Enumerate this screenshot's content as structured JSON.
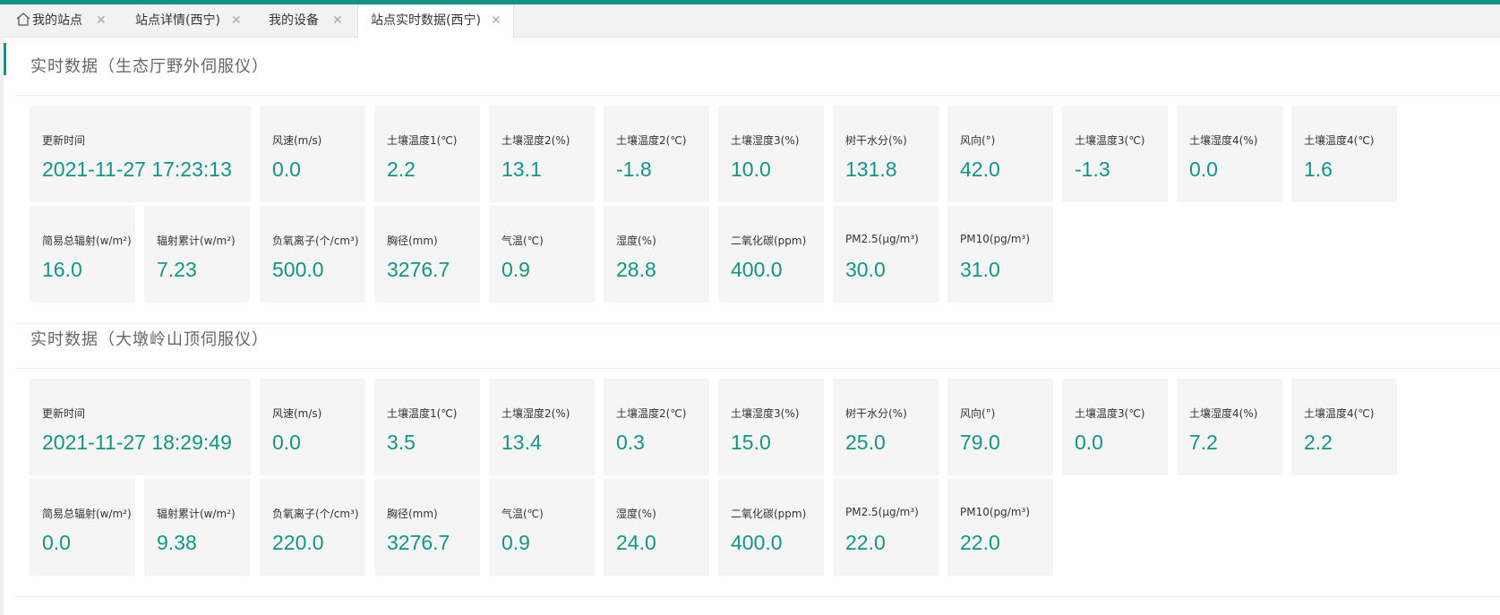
{
  "colors": {
    "accent": "#129586",
    "card_bg": "#f5f5f5",
    "value_text": "#129586"
  },
  "tabs": [
    {
      "label": "我的站点",
      "icon": "home-icon",
      "active": false
    },
    {
      "label": "站点详情(西宁)",
      "active": false
    },
    {
      "label": "我的设备",
      "active": false
    },
    {
      "label": "站点实时数据(西宁)",
      "active": true
    }
  ],
  "close_glyph": "✕",
  "sections": [
    {
      "title": "实时数据（生态厅野外伺服仪）",
      "rows": [
        [
          {
            "label": "更新时间",
            "value": "2021-11-27 17:23:13"
          },
          {
            "label": "风速(m/s)",
            "value": "0.0"
          },
          {
            "label": "土壤温度1(℃)",
            "value": "2.2"
          },
          {
            "label": "土壤湿度2(%)",
            "value": "13.1"
          },
          {
            "label": "土壤温度2(℃)",
            "value": "-1.8"
          },
          {
            "label": "土壤湿度3(%)",
            "value": "10.0"
          },
          {
            "label": "树干水分(%)",
            "value": "131.8"
          },
          {
            "label": "风向(°)",
            "value": "42.0"
          },
          {
            "label": "土壤温度3(℃)",
            "value": "-1.3"
          },
          {
            "label": "土壤湿度4(%)",
            "value": "0.0"
          },
          {
            "label": "土壤温度4(℃)",
            "value": "1.6"
          }
        ],
        [
          {
            "label": "简易总辐射(w/m²)",
            "value": "16.0"
          },
          {
            "label": "辐射累计(w/m²)",
            "value": "7.23"
          },
          {
            "label": "负氧离子(个/cm³)",
            "value": "500.0"
          },
          {
            "label": "胸径(mm)",
            "value": "3276.7"
          },
          {
            "label": "气温(℃)",
            "value": "0.9"
          },
          {
            "label": "湿度(%)",
            "value": "28.8"
          },
          {
            "label": "二氧化碳(ppm)",
            "value": "400.0"
          },
          {
            "label": "PM2.5(μg/m³)",
            "value": "30.0"
          },
          {
            "label": "PM10(pg/m³)",
            "value": "31.0"
          }
        ]
      ]
    },
    {
      "title": "实时数据（大墩岭山顶伺服仪）",
      "rows": [
        [
          {
            "label": "更新时间",
            "value": "2021-11-27 18:29:49"
          },
          {
            "label": "风速(m/s)",
            "value": "0.0"
          },
          {
            "label": "土壤温度1(℃)",
            "value": "3.5"
          },
          {
            "label": "土壤湿度2(%)",
            "value": "13.4"
          },
          {
            "label": "土壤温度2(℃)",
            "value": "0.3"
          },
          {
            "label": "土壤湿度3(%)",
            "value": "15.0"
          },
          {
            "label": "树干水分(%)",
            "value": "25.0"
          },
          {
            "label": "风向(°)",
            "value": "79.0"
          },
          {
            "label": "土壤温度3(℃)",
            "value": "0.0"
          },
          {
            "label": "土壤湿度4(%)",
            "value": "7.2"
          },
          {
            "label": "土壤温度4(℃)",
            "value": "2.2"
          }
        ],
        [
          {
            "label": "简易总辐射(w/m²)",
            "value": "0.0"
          },
          {
            "label": "辐射累计(w/m²)",
            "value": "9.38"
          },
          {
            "label": "负氧离子(个/cm³)",
            "value": "220.0"
          },
          {
            "label": "胸径(mm)",
            "value": "3276.7"
          },
          {
            "label": "气温(℃)",
            "value": "0.9"
          },
          {
            "label": "湿度(%)",
            "value": "24.0"
          },
          {
            "label": "二氧化碳(ppm)",
            "value": "400.0"
          },
          {
            "label": "PM2.5(μg/m³)",
            "value": "22.0"
          },
          {
            "label": "PM10(pg/m³)",
            "value": "22.0"
          }
        ]
      ]
    }
  ]
}
